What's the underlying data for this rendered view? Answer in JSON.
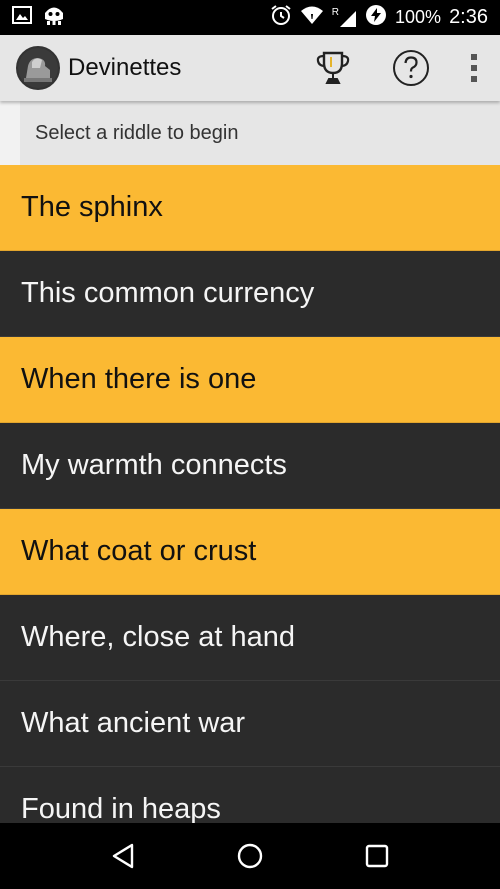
{
  "status_bar": {
    "battery": "100%",
    "time": "2:36",
    "icons": [
      "image-notification-icon",
      "cyanogen-mod-icon",
      "alarm-icon",
      "wifi-icon",
      "roaming-signal-icon",
      "battery-charging-icon"
    ],
    "roaming_label": "R"
  },
  "app_bar": {
    "title": "Devinettes",
    "actions": [
      "trophy-icon",
      "help-icon",
      "overflow-menu-icon"
    ]
  },
  "instruction": "Select a riddle to begin",
  "riddles": [
    {
      "label": "The sphinx",
      "state": "solved"
    },
    {
      "label": "This common currency",
      "state": "unsolved"
    },
    {
      "label": "When there is one",
      "state": "solved"
    },
    {
      "label": "My warmth connects",
      "state": "unsolved"
    },
    {
      "label": "What coat or crust",
      "state": "solved"
    },
    {
      "label": "Where, close at hand",
      "state": "unsolved"
    },
    {
      "label": "What ancient war",
      "state": "unsolved"
    },
    {
      "label": "Found in heaps",
      "state": "unsolved"
    }
  ],
  "colors": {
    "solved": "#fbb933",
    "unsolved": "#2b2b2b",
    "app_bar": "#e6e6e6"
  },
  "nav_bar": [
    "back-icon",
    "home-icon",
    "recents-icon"
  ]
}
